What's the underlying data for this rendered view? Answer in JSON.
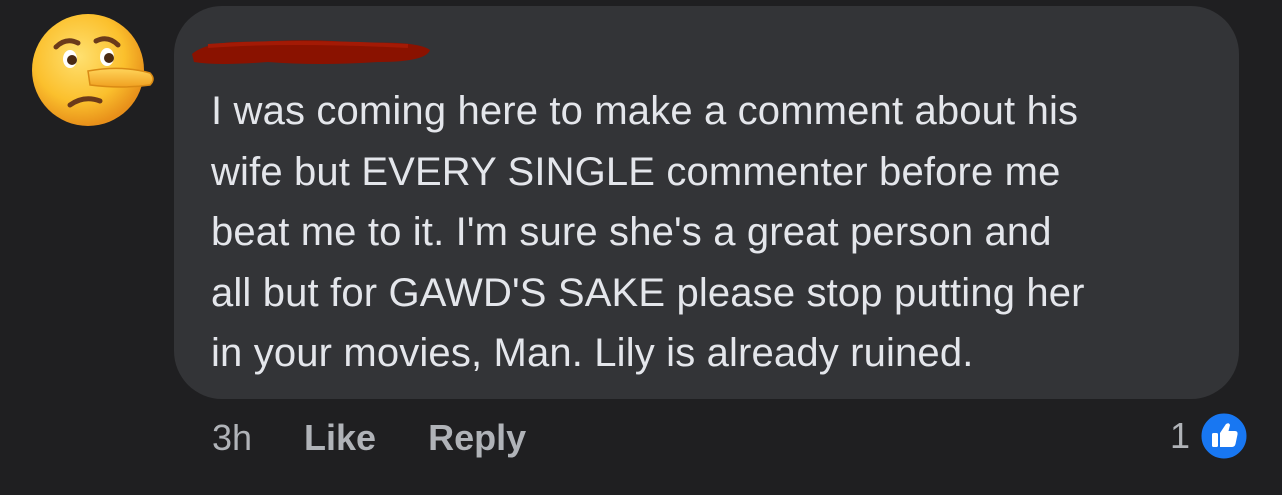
{
  "comment": {
    "avatar_icon": "lying-face-emoji-icon",
    "author_name": "",
    "text": "I was coming here to make a comment about his\nwife but EVERY SINGLE commenter before me\nbeat me to it.  I'm sure she's a great person and\nall but for GAWD'S SAKE please stop putting her\nin your movies, Man.  Lily is already ruined.",
    "timestamp": "3h",
    "like_label": "Like",
    "reply_label": "Reply",
    "reaction_count": "1",
    "reaction_icon": "thumbs-up-icon"
  },
  "colors": {
    "background": "#1f1f21",
    "bubble": "#333437",
    "text": "#e4e6eb",
    "secondary_text": "#b0b3b8",
    "like_blue": "#1877f2",
    "redaction": "#8a1200"
  }
}
